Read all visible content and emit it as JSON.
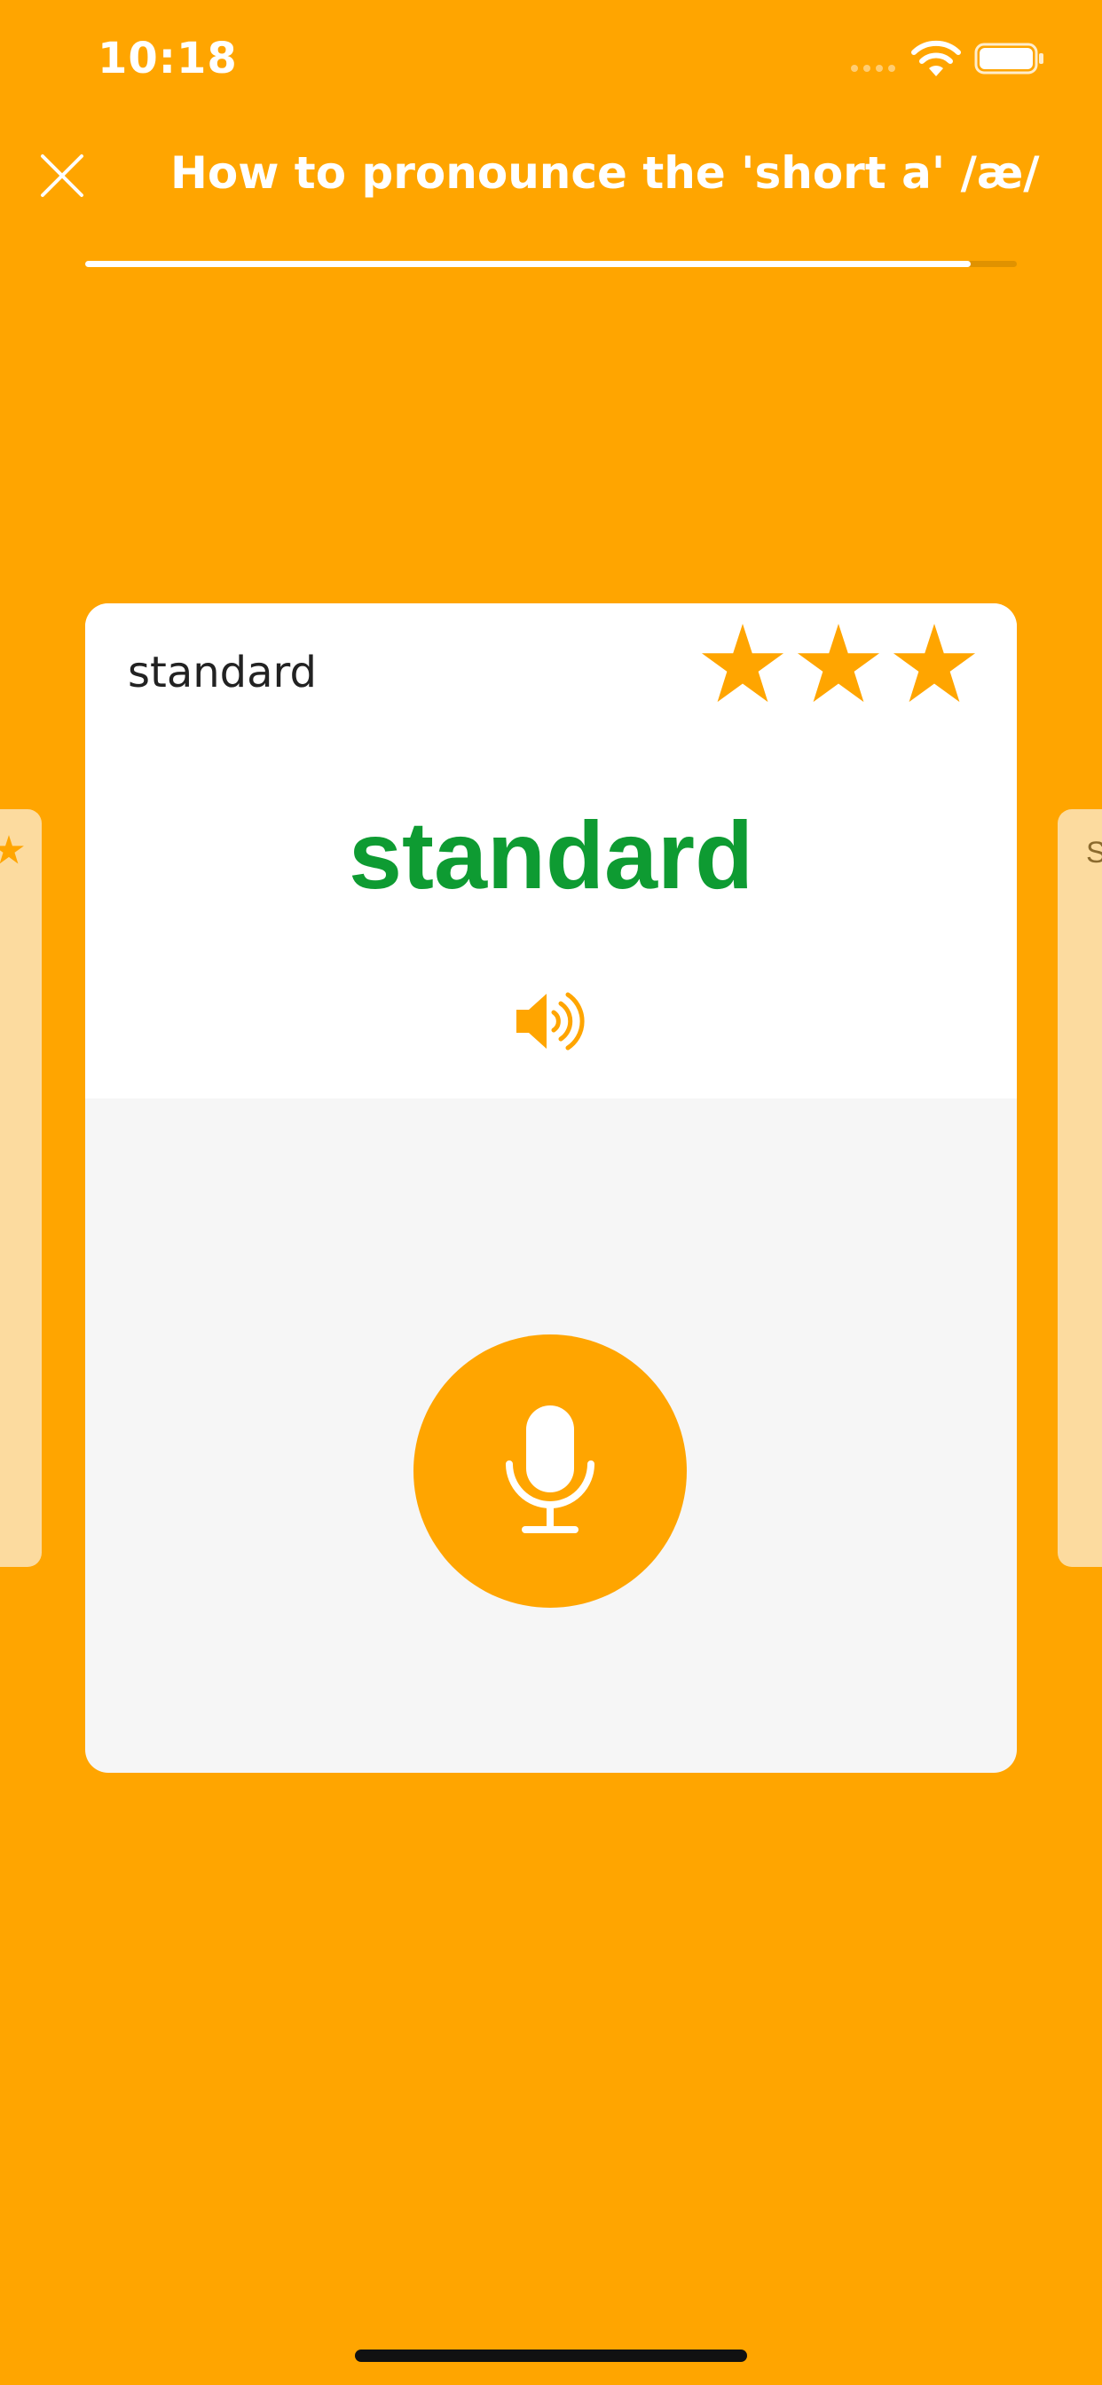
{
  "status_bar": {
    "time": "10:18"
  },
  "header": {
    "title": "How to pronounce the 'short a' /æ/"
  },
  "progress": {
    "fraction": 0.95
  },
  "card": {
    "label": "standard",
    "word": "standard",
    "stars": 3,
    "word_color": "#0E9B32"
  },
  "side_card_right": {
    "peek_text": "S"
  },
  "colors": {
    "accent": "#FFA500",
    "card_background": "#FFFFFF",
    "card_bottom_background": "#F6F6F6",
    "side_card": "#FCDB9F"
  },
  "icons": [
    "close-icon",
    "wifi-icon",
    "battery-icon",
    "star-icon",
    "speaker-icon",
    "microphone-icon"
  ]
}
